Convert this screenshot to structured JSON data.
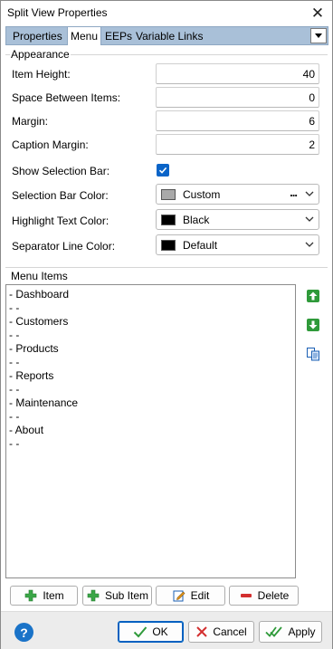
{
  "window": {
    "title": "Split View Properties",
    "close_glyph": "✕"
  },
  "tabs": [
    {
      "label": "Properties",
      "active": false
    },
    {
      "label": "Menu",
      "active": true
    },
    {
      "label": "EEPs",
      "active": false
    },
    {
      "label": "Variable Links",
      "active": false
    }
  ],
  "appearance": {
    "group_label": "Appearance",
    "item_height": {
      "label": "Item Height:",
      "value": "40"
    },
    "space_between": {
      "label": "Space Between Items:",
      "value": "0"
    },
    "margin": {
      "label": "Margin:",
      "value": "6"
    },
    "caption_margin": {
      "label": "Caption Margin:",
      "value": "2"
    },
    "show_selection_bar": {
      "label": "Show Selection Bar:",
      "checked": true
    },
    "selection_bar_color": {
      "label": "Selection Bar Color:",
      "value": "Custom",
      "swatch": "#a9a9a9",
      "ellipsis": "..."
    },
    "highlight_text_color": {
      "label": "Highlight Text Color:",
      "value": "Black",
      "swatch": "#000000"
    },
    "separator_line_color": {
      "label": "Separator Line Color:",
      "value": "Default",
      "swatch": "#000000"
    }
  },
  "menu_items": {
    "group_label": "Menu Items",
    "lines": [
      "- Dashboard",
      "- -",
      "- Customers",
      "- -",
      "- Products",
      "- -",
      "- Reports",
      "- -",
      "- Maintenance",
      "- -",
      "- About",
      "- -"
    ]
  },
  "item_buttons": {
    "item": "Item",
    "sub_item": "Sub Item",
    "edit": "Edit",
    "delete": "Delete"
  },
  "dialog_buttons": {
    "help": "?",
    "ok": "OK",
    "cancel": "Cancel",
    "apply": "Apply"
  },
  "colors": {
    "accent": "#0a64c8",
    "tab_strip": "#a9c0d8",
    "green": "#2f9a3a",
    "red": "#d32f2f"
  }
}
